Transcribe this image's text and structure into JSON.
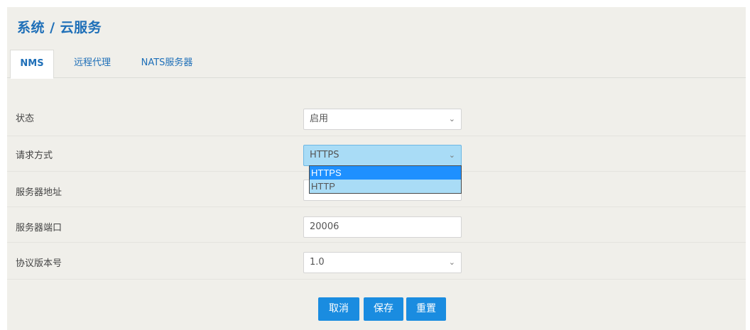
{
  "page": {
    "title": "系统 / 云服务"
  },
  "tabs": [
    {
      "label": "NMS",
      "active": true
    },
    {
      "label": "远程代理",
      "active": false
    },
    {
      "label": "NATS服务器",
      "active": false
    }
  ],
  "form": {
    "status": {
      "label": "状态",
      "value": "启用"
    },
    "request_method": {
      "label": "请求方式",
      "value": "HTTPS",
      "options": [
        "HTTPS",
        "HTTP"
      ],
      "selected_option": "HTTPS"
    },
    "server_address": {
      "label": "服务器地址",
      "value": ""
    },
    "server_port": {
      "label": "服务器端口",
      "value": "20006"
    },
    "protocol_version": {
      "label": "协议版本号",
      "value": "1.0"
    }
  },
  "buttons": {
    "cancel": "取消",
    "save": "保存",
    "reset": "重置"
  },
  "icons": {
    "select_arrow": "chevron-down-icon"
  },
  "colors": {
    "accent": "#1a8ce0",
    "title": "#1e6fb8",
    "focus": "#a9dcf6",
    "option_selected": "#1e90ff",
    "panel_bg": "#f0efea"
  }
}
